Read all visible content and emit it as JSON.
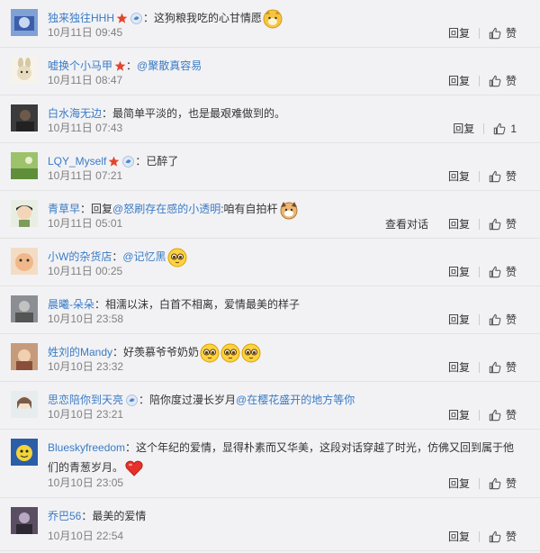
{
  "comments": [
    {
      "user": "独来独往HHH",
      "user_color": "#3a7bc4",
      "badges": [
        "star-badge",
        "vip-badge"
      ],
      "parts": [
        {
          "t": "text",
          "v": "：这狗粮我吃的心甘情愿"
        },
        {
          "t": "emoji",
          "v": "doge"
        }
      ],
      "time": "10月11日 09:45",
      "reply": "回复",
      "like": "赞",
      "view_conv": null,
      "avatar": "blue"
    },
    {
      "user": "嘘换个小马甲",
      "user_color": "#3a7bc4",
      "badges": [
        "star-badge"
      ],
      "parts": [
        {
          "t": "text",
          "v": "："
        },
        {
          "t": "mention",
          "v": "@聚散真容易"
        }
      ],
      "time": "10月11日 08:47",
      "reply": "回复",
      "like": "赞",
      "view_conv": null,
      "avatar": "rabbit"
    },
    {
      "user": "白水海无边",
      "user_color": "#3a7bc4",
      "badges": [],
      "parts": [
        {
          "t": "text",
          "v": "：最简单平淡的，也是最艰难做到的。"
        }
      ],
      "time": "10月11日 07:43",
      "reply": "回复",
      "like": "1",
      "view_conv": null,
      "avatar": "dark"
    },
    {
      "user": "LQY_Myself",
      "user_color": "#3a7bc4",
      "badges": [
        "star-badge",
        "vip-badge"
      ],
      "parts": [
        {
          "t": "text",
          "v": "：已醉了"
        }
      ],
      "time": "10月11日 07:21",
      "reply": "回复",
      "like": "赞",
      "view_conv": null,
      "avatar": "green"
    },
    {
      "user": "青草早",
      "user_color": "#3a7bc4",
      "badges": [],
      "parts": [
        {
          "t": "text",
          "v": "：回复"
        },
        {
          "t": "mention",
          "v": "@怒刷存在感的小透明"
        },
        {
          "t": "text",
          "v": ":咱有自拍杆"
        },
        {
          "t": "emoji",
          "v": "dog"
        }
      ],
      "time": "10月11日 05:01",
      "reply": "回复",
      "like": "赞",
      "view_conv": "查看对话",
      "avatar": "boy"
    },
    {
      "user": "小W的杂货店",
      "user_color": "#3a7bc4",
      "badges": [],
      "parts": [
        {
          "t": "text",
          "v": "："
        },
        {
          "t": "mention",
          "v": "@记忆黑"
        },
        {
          "t": "emoji",
          "v": "adore"
        }
      ],
      "time": "10月11日 00:25",
      "reply": "回复",
      "like": "赞",
      "view_conv": null,
      "avatar": "cat"
    },
    {
      "user": "晨曦-朵朵",
      "user_color": "#3a7bc4",
      "badges": [],
      "parts": [
        {
          "t": "text",
          "v": "：相濡以沫，白首不相离，爱情最美的样子"
        }
      ],
      "time": "10月10日 23:58",
      "reply": "回复",
      "like": "赞",
      "view_conv": null,
      "avatar": "gray"
    },
    {
      "user": "姓刘的Mandy",
      "user_color": "#3a7bc4",
      "badges": [],
      "parts": [
        {
          "t": "text",
          "v": "：好羡慕爷爷奶奶"
        },
        {
          "t": "emoji",
          "v": "adore"
        },
        {
          "t": "emoji",
          "v": "adore"
        },
        {
          "t": "emoji",
          "v": "adore"
        }
      ],
      "time": "10月10日 23:32",
      "reply": "回复",
      "like": "赞",
      "view_conv": null,
      "avatar": "doll"
    },
    {
      "user": "思恋陪你到天亮",
      "user_color": "#3a7bc4",
      "badges": [
        "vip-badge"
      ],
      "parts": [
        {
          "t": "text",
          "v": "：陪你度过漫长岁月"
        },
        {
          "t": "mention",
          "v": "@在樱花盛开的地方等你"
        }
      ],
      "time": "10月10日 23:21",
      "reply": "回复",
      "like": "赞",
      "view_conv": null,
      "avatar": "anime"
    },
    {
      "user": "Blueskyfreedom",
      "user_color": "#3a7bc4",
      "badges": [],
      "parts": [
        {
          "t": "text",
          "v": "：这个年纪的爱情，显得朴素而又华美，这段对话穿越了时光，仿佛又回到属于他们的青葱岁月。"
        },
        {
          "t": "emoji",
          "v": "heart"
        }
      ],
      "time": "10月10日 23:05",
      "reply": "回复",
      "like": "赞",
      "view_conv": null,
      "avatar": "yellow"
    },
    {
      "user": "乔巴56",
      "user_color": "#3a7bc4",
      "badges": [],
      "parts": [
        {
          "t": "text",
          "v": "：最美的爱情"
        }
      ],
      "time": "10月10日 22:54",
      "reply": "回复",
      "like": "赞",
      "view_conv": null,
      "avatar": "dark2"
    }
  ]
}
